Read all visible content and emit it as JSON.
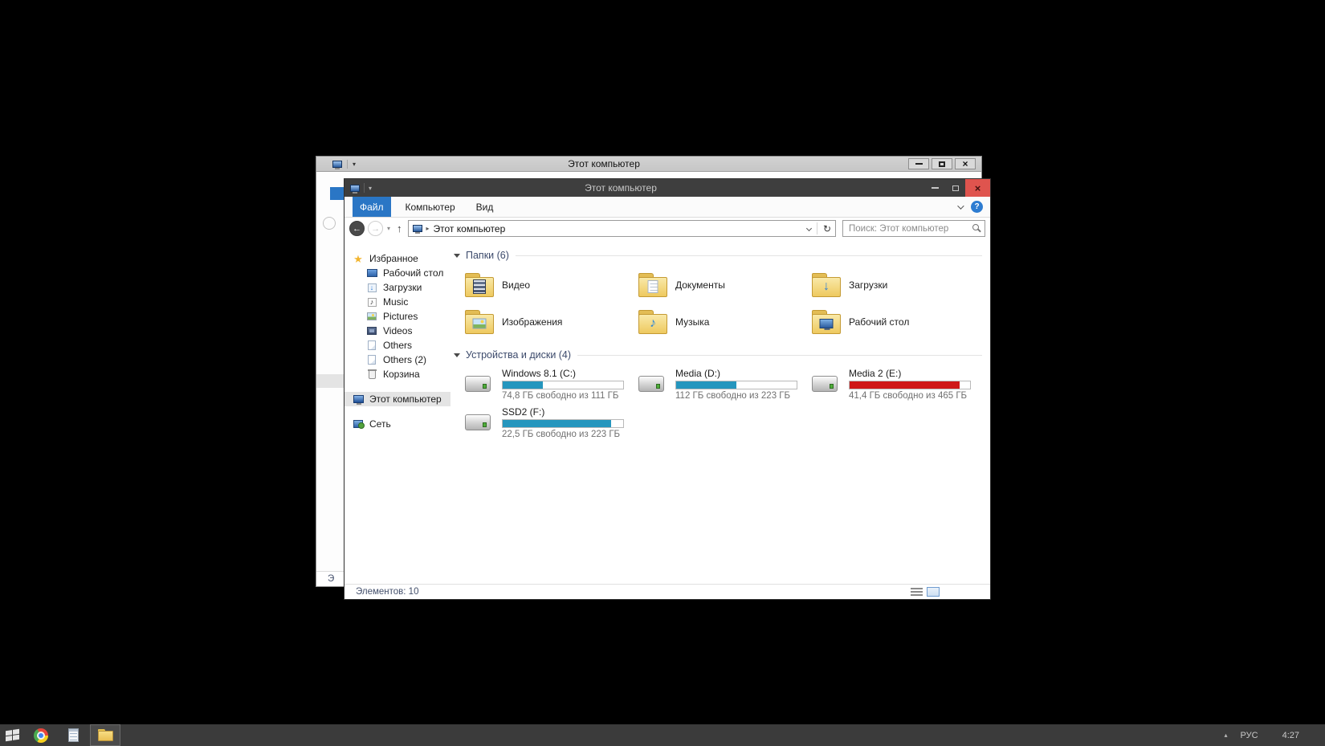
{
  "colors": {
    "accent": "#2a76c5",
    "titlebar_dark": "#3e3e3e",
    "titlebar_light": "#cbcbcb",
    "close_red": "#df544e",
    "bar_used": "#2596be",
    "bar_used_low": "#cf1717",
    "taskbar": "#3b3b3b",
    "selection": "#e4e4e4",
    "header_text": "#3c4a6b",
    "status_text": "#44506c"
  },
  "glyphs": {
    "close": "×",
    "back_arrow": "←",
    "up_arrow": "↑",
    "refresh": "↻",
    "dropdown_caret": "▾",
    "breadcrumb_arrow": "▸",
    "help": "?",
    "tray_chevron": "▴"
  },
  "back_window": {
    "title": "Этот компьютер",
    "status_fragment": "Э"
  },
  "window": {
    "title": "Этот компьютер",
    "tabs": [
      {
        "label": "Файл",
        "active": true
      },
      {
        "label": "Компьютер",
        "active": false
      },
      {
        "label": "Вид",
        "active": false
      }
    ],
    "nav": {
      "path": "Этот компьютер",
      "search_placeholder": "Поиск: Этот компьютер"
    },
    "sidebar": {
      "items": [
        {
          "label": "Избранное",
          "icon": "star-icon",
          "glyph": "★"
        },
        {
          "label": "Рабочий стол",
          "icon": "desktop-mini-icon",
          "indent": true
        },
        {
          "label": "Загрузки",
          "icon": "download-mini-icon",
          "glyph": "↓",
          "indent": true
        },
        {
          "label": "Music",
          "icon": "music-mini-icon",
          "glyph": "♪",
          "indent": true
        },
        {
          "label": "Pictures",
          "icon": "pictures-mini-icon",
          "indent": true
        },
        {
          "label": "Videos",
          "icon": "videos-mini-icon",
          "indent": true
        },
        {
          "label": "Others",
          "icon": "others-mini-icon",
          "indent": true
        },
        {
          "label": "Others (2)",
          "icon": "others-mini-icon",
          "indent": true
        },
        {
          "label": "Корзина",
          "icon": "recycle-mini-icon",
          "indent": true
        },
        {
          "label": "Этот компьютер",
          "icon": "computer-mini-icon",
          "selected": true,
          "gap": true
        },
        {
          "label": "Сеть",
          "icon": "network-mini-icon",
          "gap": true
        }
      ]
    },
    "folders_section": {
      "header": "Папки (6)",
      "items": [
        {
          "label": "Видео",
          "icon": "video-folder-icon"
        },
        {
          "label": "Документы",
          "icon": "documents-folder-icon"
        },
        {
          "label": "Загрузки",
          "icon": "downloads-folder-icon",
          "glyph": "↓"
        },
        {
          "label": "Изображения",
          "icon": "pictures-folder-icon"
        },
        {
          "label": "Музыка",
          "icon": "music-folder-icon",
          "glyph": "♪"
        },
        {
          "label": "Рабочий стол",
          "icon": "desktop-folder-icon"
        }
      ]
    },
    "drives_section": {
      "header": "Устройства и диски (4)",
      "items": [
        {
          "name": "Windows 8.1 (C:)",
          "free": "74,8 ГБ свободно из 111 ГБ",
          "used_pct": 33,
          "low": false,
          "icon": "hard-drive-icon"
        },
        {
          "name": "Media (D:)",
          "free": "112 ГБ свободно из 223 ГБ",
          "used_pct": 50,
          "low": false,
          "icon": "hard-drive-icon"
        },
        {
          "name": "Media 2 (E:)",
          "free": "41,4 ГБ свободно из 465 ГБ",
          "used_pct": 91,
          "low": true,
          "icon": "hard-drive-icon"
        },
        {
          "name": "SSD2 (F:)",
          "free": "22,5 ГБ свободно из 223 ГБ",
          "used_pct": 90,
          "low": false,
          "icon": "hard-drive-icon"
        }
      ]
    },
    "status": {
      "items_count": "Элементов: 10"
    }
  },
  "taskbar": {
    "buttons": [
      {
        "icon": "chrome-icon",
        "active": false
      },
      {
        "icon": "notepad-icon",
        "active": false
      },
      {
        "icon": "file-explorer-icon",
        "active": true
      }
    ],
    "language": "РУС",
    "time": "4:27"
  }
}
